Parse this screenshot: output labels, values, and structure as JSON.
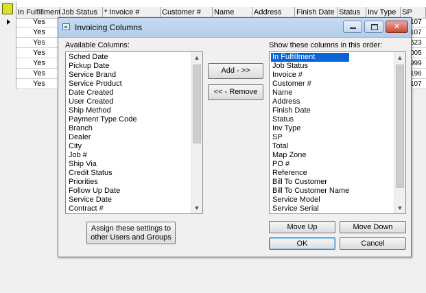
{
  "grid": {
    "columns": [
      "In Fulfillment",
      "Job Status",
      "* Invoice #",
      "Customer #",
      "Name",
      "Address",
      "Finish Date",
      "Status",
      "Inv Type",
      "SP"
    ],
    "rows": [
      {
        "fulfillment": "Yes",
        "sp": "107"
      },
      {
        "fulfillment": "Yes",
        "sp": "107"
      },
      {
        "fulfillment": "Yes",
        "sp": "623"
      },
      {
        "fulfillment": "Yes",
        "sp": "005"
      },
      {
        "fulfillment": "Yes",
        "sp": "999"
      },
      {
        "fulfillment": "Yes",
        "sp": "196"
      },
      {
        "fulfillment": "Yes",
        "sp": "107"
      }
    ]
  },
  "dialog": {
    "title": "Invoicing Columns",
    "available_label": "Available Columns:",
    "available": [
      "Sched Date",
      "Pickup Date",
      "Service Brand",
      "Service Product",
      "Date Created",
      "User Created",
      "Ship Method",
      "Payment Type Code",
      "Branch",
      "Dealer",
      "City",
      "Job #",
      "Ship Via",
      "Credit Status",
      "Priorities",
      "Follow Up Date",
      "Service Date",
      "Contract #"
    ],
    "shown_label": "Show these columns in this order:",
    "shown": [
      "In Fulfillment",
      "Job Status",
      "Invoice #",
      "Customer #",
      "Name",
      "Address",
      "Finish Date",
      "Status",
      "Inv Type",
      "SP",
      "Total",
      "Map Zone",
      "PO #",
      "Reference",
      "Bill To Customer",
      "Bill To Customer Name",
      "Service Model",
      "Service Serial"
    ],
    "shown_selected_index": 0,
    "buttons": {
      "add": "Add - >>",
      "remove": "<< - Remove",
      "assign_line1": "Assign these settings to",
      "assign_line2": "other Users and Groups",
      "move_up": "Move Up",
      "move_down": "Move Down",
      "ok": "OK",
      "cancel": "Cancel"
    }
  }
}
